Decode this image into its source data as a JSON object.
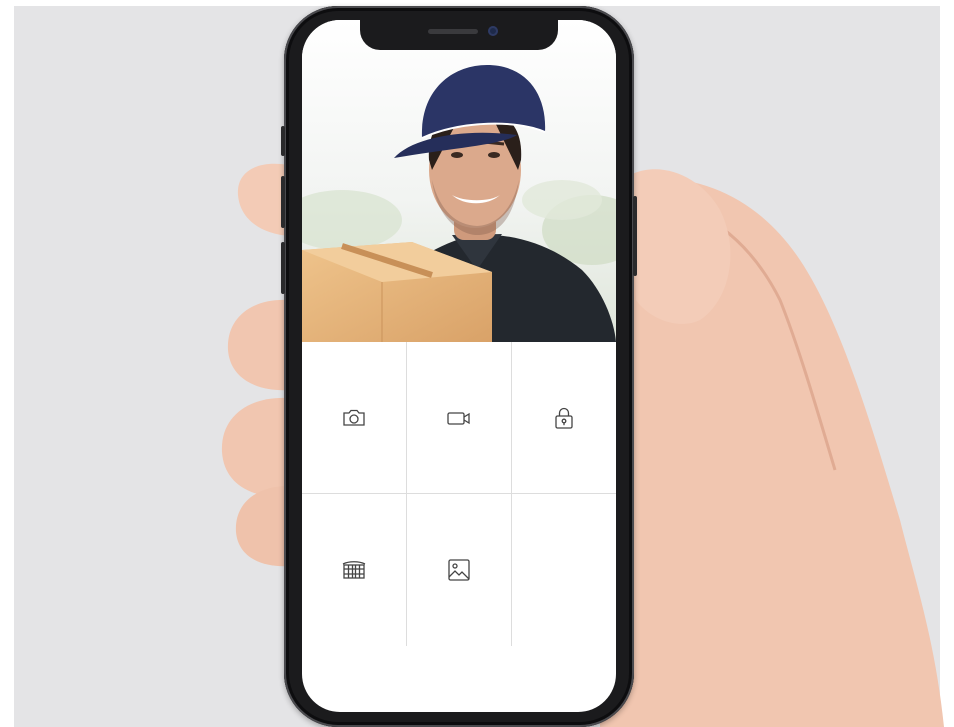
{
  "screen": {
    "feed": {
      "subject": "delivery-person-with-parcel",
      "colors": {
        "cap": "#2b3566",
        "shirt": "#23282e",
        "box": "#e6b57a"
      }
    },
    "actions": [
      {
        "name": "snapshot-button",
        "icon": "camera-icon"
      },
      {
        "name": "record-button",
        "icon": "video-camera-icon"
      },
      {
        "name": "unlock-button",
        "icon": "lock-icon"
      },
      {
        "name": "gate-button",
        "icon": "gate-icon"
      },
      {
        "name": "gallery-button",
        "icon": "image-icon"
      }
    ]
  },
  "colors": {
    "background": "#e4e4e6",
    "phone_frame": "#1b1b1d",
    "icon_stroke": "#444444",
    "grid_line": "#dddddd"
  }
}
